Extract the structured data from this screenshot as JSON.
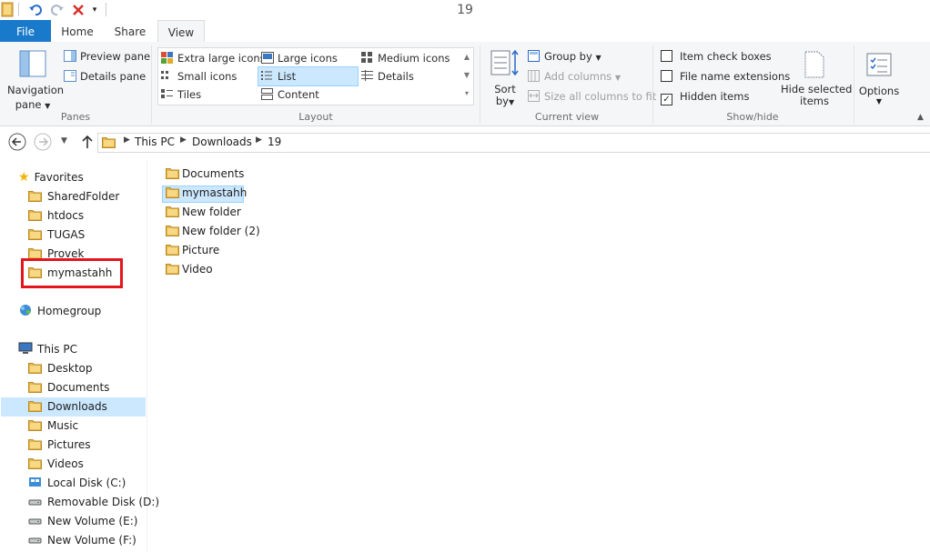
{
  "window": {
    "title": "19"
  },
  "tabs": {
    "file": "File",
    "home": "Home",
    "share": "Share",
    "view": "View"
  },
  "ribbon": {
    "panes": {
      "navigation_pane_line1": "Navigation",
      "navigation_pane_line2": "pane",
      "preview_pane": "Preview pane",
      "details_pane": "Details pane",
      "group_label": "Panes"
    },
    "layout": {
      "extra_large_icons": "Extra large icons",
      "large_icons": "Large icons",
      "medium_icons": "Medium icons",
      "small_icons": "Small icons",
      "list": "List",
      "details": "Details",
      "tiles": "Tiles",
      "content": "Content",
      "group_label": "Layout",
      "selected": "List"
    },
    "current_view": {
      "sort_by_line1": "Sort",
      "sort_by_line2": "by",
      "group_by": "Group by",
      "add_columns": "Add columns",
      "size_all_columns": "Size all columns to fit",
      "group_label": "Current view"
    },
    "show_hide": {
      "item_check_boxes": "Item check boxes",
      "file_name_extensions": "File name extensions",
      "hidden_items": "Hidden items",
      "hide_selected_line1": "Hide selected",
      "hide_selected_line2": "items",
      "group_label": "Show/hide",
      "item_check_boxes_checked": false,
      "file_name_extensions_checked": false,
      "hidden_items_checked": true
    },
    "options": {
      "label": "Options"
    }
  },
  "address": {
    "breadcrumbs": [
      "This PC",
      "Downloads",
      "19"
    ]
  },
  "nav_pane": {
    "favorites_header": "Favorites",
    "favorites": [
      "SharedFolder",
      "htdocs",
      "TUGAS",
      "Provek",
      "mymastahh"
    ],
    "homegroup": "Homegroup",
    "this_pc_header": "This PC",
    "this_pc_items": [
      "Desktop",
      "Documents",
      "Downloads",
      "Music",
      "Pictures",
      "Videos",
      "Local Disk (C:)",
      "Removable Disk (D:)",
      "New Volume (E:)",
      "New Volume (F:)"
    ],
    "selected": "Downloads",
    "highlight_color": "#e3161e"
  },
  "content": {
    "items": [
      "Documents",
      "mymastahh",
      "New folder",
      "New folder (2)",
      "Picture",
      "Video"
    ],
    "selected": "mymastahh"
  },
  "colors": {
    "accent": "#1979ca",
    "selection": "#cce8ff",
    "folder": "#e8b64a"
  }
}
